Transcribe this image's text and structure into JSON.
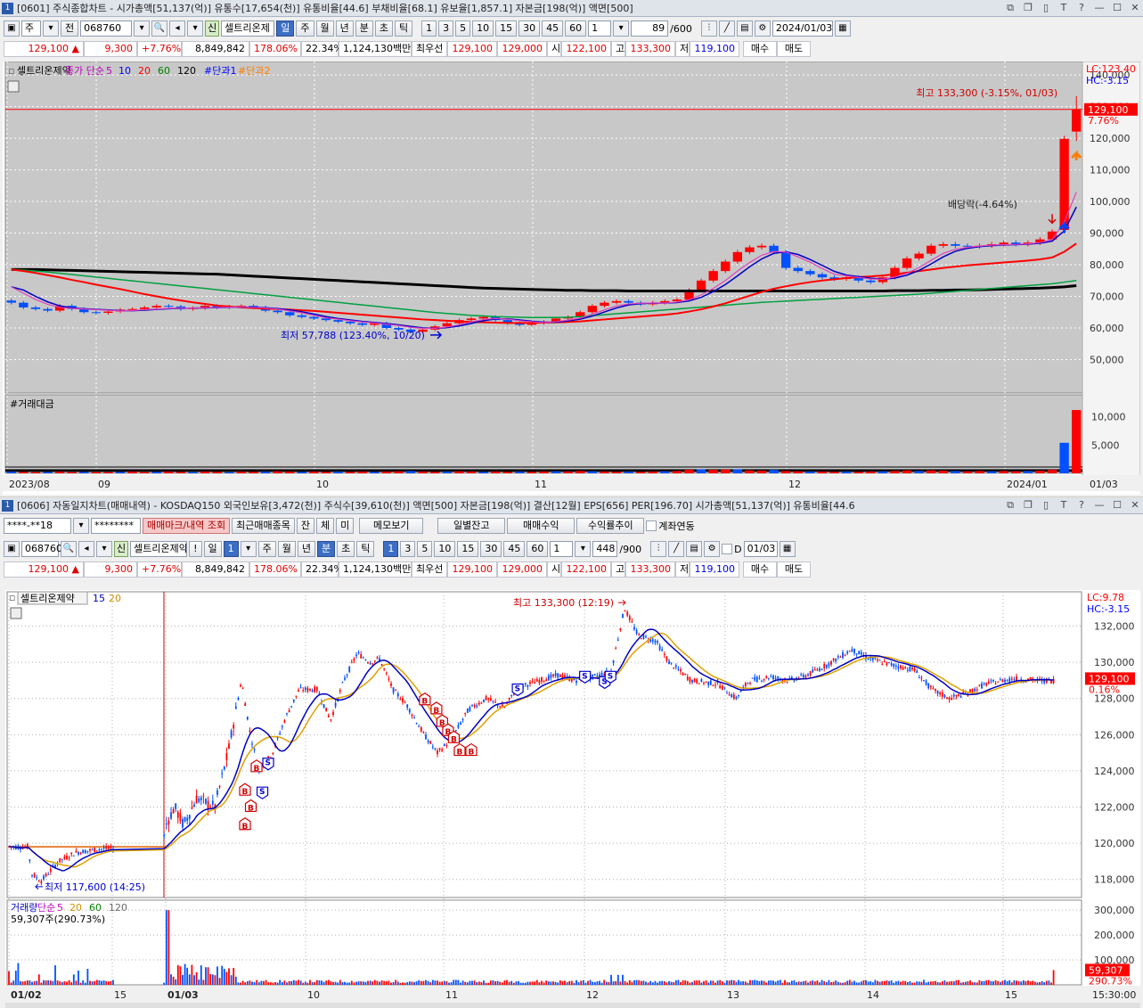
{
  "top": {
    "title_num": "1",
    "title": "[0601] 주식종합차트 - 시가총액[51,137(억)] 유통수[17,654(천)] 유통비율[44.6] 부채비율[68.1] 유보율[1,857.1] 자본금[198(억)] 액면[500]",
    "toolbar": {
      "type_sel": "주",
      "prev": "전",
      "code": "068760",
      "credit": "신",
      "name": "셀트리온제",
      "periods": [
        "일",
        "주",
        "월",
        "년",
        "분",
        "초",
        "틱"
      ],
      "active_period": "일",
      "nums": [
        "1",
        "3",
        "5",
        "10",
        "15",
        "30",
        "45",
        "60"
      ],
      "count_sel": "1",
      "count": "89",
      "count_max": "/600",
      "date": "2024/01/03"
    },
    "quote": {
      "price": "129,100",
      "change": "9,300",
      "rate": "+7.76%",
      "volume": "8,849,842",
      "vol_ratio": "178.06%",
      "turnover": "22.34%",
      "amount": "1,124,130백만",
      "best_label": "최우선",
      "ask": "129,100",
      "bid": "129,000",
      "open_label": "시",
      "open": "122,100",
      "high_label": "고",
      "high": "133,300",
      "low_label": "저",
      "low": "119,100",
      "buy": "매수",
      "sell": "매도"
    },
    "legend": {
      "name": "셀트리온제약",
      "ma_label": "종가 단순",
      "ma5": "5",
      "ma10": "10",
      "ma20": "20",
      "ma60": "60",
      "ma120": "120",
      "tr1": "#단과1",
      "tr2": "#단과2",
      "volume_title": "#거래대금"
    },
    "right_info": {
      "lc": "LC:123.40",
      "hc": "HC:-3.15"
    },
    "current": {
      "price": "129,100",
      "pct": "7.76%"
    },
    "annot_high": "최고 133,300 (-3.15%, 01/03)",
    "annot_low": "최저 57,788 (123.40%, 10/20)",
    "annot_div": "배당락(-4.64%)",
    "x_labels": [
      "2023/08",
      "09",
      "10",
      "11",
      "12",
      "2024/01"
    ],
    "x_right": "01/03",
    "chart_data": {
      "type": "candlestick",
      "y_ticks": [
        "140,000",
        "130,000",
        "120,000",
        "110,000",
        "100,000",
        "90,000",
        "80,000",
        "70,000",
        "60,000",
        "50,000"
      ],
      "ylim": [
        40000,
        142000
      ],
      "volume_ticks": [
        "10,000",
        "5,000"
      ],
      "closes": [
        68000,
        66500,
        66000,
        65500,
        67000,
        66000,
        65000,
        64800,
        65200,
        65800,
        66000,
        66500,
        67000,
        66800,
        66000,
        66300,
        67000,
        66500,
        66800,
        67000,
        66500,
        65500,
        65000,
        64000,
        63500,
        63000,
        62500,
        62000,
        61500,
        61000,
        61500,
        60000,
        59500,
        58800,
        59500,
        60500,
        61500,
        62500,
        63000,
        63500,
        62500,
        61500,
        61000,
        61500,
        62000,
        63000,
        63500,
        65000,
        67000,
        68000,
        68500,
        68000,
        67500,
        68000,
        68500,
        69000,
        72000,
        75000,
        78000,
        81000,
        84000,
        85500,
        86000,
        84000,
        79000,
        78000,
        77000,
        76000,
        75500,
        76000,
        75000,
        74500,
        76000,
        79000,
        82000,
        83500,
        86000,
        86500,
        86000,
        85800,
        86000,
        86500,
        87000,
        86500,
        87000,
        88000,
        90500,
        119800,
        129100
      ],
      "ma5": [
        73000,
        71000,
        69000,
        67500,
        66500,
        66200,
        66000,
        65800,
        65600,
        65400,
        65500,
        65800,
        66000,
        66200,
        66300,
        66300,
        66400,
        66500,
        66600,
        66600,
        66500,
        66300,
        66000,
        65400,
        64800,
        64000,
        63200,
        62800,
        62300,
        61900,
        61600,
        61200,
        60800,
        60200,
        59900,
        59900,
        60300,
        61000,
        61900,
        62700,
        63000,
        62800,
        62300,
        62000,
        61700,
        62000,
        62500,
        63100,
        64400,
        65700,
        67000,
        67600,
        67800,
        67900,
        67900,
        68200,
        68900,
        70500,
        72500,
        75000,
        78000,
        80700,
        83000,
        84200,
        84000,
        82500,
        80800,
        78800,
        77000,
        76500,
        76000,
        75500,
        75400,
        76100,
        77300,
        79100,
        81400,
        83600,
        84900,
        85500,
        85900,
        86200,
        86300,
        86400,
        86600,
        87000,
        87900,
        93500,
        103000
      ],
      "ma20": [
        78500,
        78000,
        77400,
        76700,
        76000,
        75200,
        74500,
        73700,
        73000,
        72300,
        71500,
        70700,
        70000,
        69300,
        68700,
        68100,
        67600,
        67100,
        66800,
        66500,
        66300,
        66100,
        66000,
        65800,
        65600,
        65400,
        65100,
        64800,
        64500,
        64200,
        63900,
        63600,
        63300,
        63000,
        62700,
        62500,
        62300,
        62100,
        61900,
        61800,
        61700,
        61600,
        61600,
        61600,
        61700,
        61800,
        61900,
        62100,
        62400,
        62700,
        63000,
        63300,
        63600,
        63900,
        64200,
        64600,
        65200,
        65900,
        66800,
        67800,
        69000,
        70200,
        71400,
        72400,
        73200,
        73900,
        74500,
        75000,
        75400,
        75800,
        76100,
        76300,
        76600,
        77000,
        77500,
        78000,
        78500,
        79000,
        79400,
        79800,
        80100,
        80400,
        80700,
        81000,
        81300,
        81700,
        82300,
        84100,
        86700
      ],
      "ma60": [
        78500,
        78300,
        78000,
        77700,
        77300,
        76900,
        76500,
        76100,
        75700,
        75300,
        74900,
        74500,
        74100,
        73700,
        73300,
        72900,
        72500,
        72100,
        71700,
        71300,
        70900,
        70500,
        70100,
        69700,
        69300,
        68900,
        68500,
        68100,
        67700,
        67300,
        66900,
        66500,
        66100,
        65700,
        65300,
        64900,
        64600,
        64300,
        64000,
        63800,
        63600,
        63500,
        63400,
        63300,
        63300,
        63300,
        63400,
        63600,
        63900,
        64200,
        64500,
        64800,
        65100,
        65400,
        65700,
        66000,
        66300,
        66600,
        66900,
        67200,
        67500,
        67800,
        68100,
        68300,
        68500,
        68700,
        68900,
        69100,
        69300,
        69500,
        69700,
        69900,
        70100,
        70300,
        70500,
        70700,
        71000,
        71300,
        71600,
        71900,
        72200,
        72500,
        72800,
        73100,
        73400,
        73700,
        74000,
        74500,
        75000
      ],
      "ma120": [
        78500,
        78500,
        78500,
        78400,
        78300,
        78200,
        78100,
        78000,
        77900,
        77800,
        77700,
        77600,
        77500,
        77400,
        77300,
        77200,
        77100,
        77000,
        76800,
        76600,
        76400,
        76200,
        76000,
        75800,
        75600,
        75400,
        75200,
        75000,
        74800,
        74600,
        74400,
        74200,
        74000,
        73800,
        73600,
        73400,
        73200,
        73000,
        72800,
        72600,
        72500,
        72400,
        72300,
        72200,
        72100,
        72000,
        71900,
        71900,
        71800,
        71800,
        71800,
        71700,
        71700,
        71700,
        71700,
        71700,
        71700,
        71700,
        71700,
        71700,
        71700,
        71700,
        71700,
        71700,
        71700,
        71700,
        71700,
        71700,
        71700,
        71700,
        71700,
        71700,
        71700,
        71800,
        71800,
        71800,
        71900,
        71900,
        72000,
        72000,
        72100,
        72200,
        72300,
        72400,
        72500,
        72600,
        72800,
        73000,
        73400
      ],
      "volume": [
        300,
        250,
        200,
        250,
        300,
        200,
        250,
        200,
        200,
        250,
        300,
        200,
        250,
        300,
        250,
        200,
        300,
        250,
        200,
        300,
        250,
        300,
        350,
        300,
        250,
        300,
        250,
        300,
        250,
        300,
        250,
        300,
        350,
        400,
        300,
        250,
        300,
        350,
        300,
        250,
        300,
        250,
        300,
        250,
        300,
        350,
        300,
        400,
        350,
        300,
        250,
        300,
        250,
        300,
        350,
        400,
        600,
        700,
        600,
        650,
        700,
        500,
        450,
        600,
        400,
        350,
        300,
        300,
        250,
        300,
        250,
        300,
        350,
        400,
        500,
        400,
        500,
        450,
        400,
        350,
        400,
        350,
        400,
        350,
        400,
        450,
        600,
        5400,
        11200
      ]
    }
  },
  "bottom": {
    "title_num": "1",
    "title": "[0606] 자동일지차트(매매내역) - KOSDAQ150 외국인보유[3,472(천)] 주식수[39,610(천)] 액면[500] 자본금[198(억)] 결산[12월] EPS[656] PER[196.70] 시가총액[51,137(억)] 유통비율[44.6",
    "account": "****-**18",
    "password": "********",
    "btns": [
      "매매마크/내역 조회",
      "최근매매종목",
      "잔",
      "체",
      "미",
      "메모보기",
      "일별잔고",
      "매매수익",
      "수익률추이"
    ],
    "account_link": "계좌연동",
    "toolbar": {
      "code": "068760",
      "credit": "신",
      "name": "셀트리온제약",
      "bang": "!",
      "period": "일",
      "period_num": "1",
      "periods": [
        "주",
        "월",
        "년",
        "분",
        "초",
        "틱"
      ],
      "active_period": "분",
      "nums": [
        "1",
        "3",
        "5",
        "10",
        "15",
        "30",
        "45",
        "60"
      ],
      "active_num": "1",
      "count_sel": "1",
      "count": "448",
      "count_max": "/900",
      "d_label": "D",
      "date": "01/03"
    },
    "quote": {
      "price": "129,100",
      "change": "9,300",
      "rate": "+7.76%",
      "volume": "8,849,842",
      "vol_ratio": "178.06%",
      "turnover": "22.34%",
      "amount": "1,124,130백만",
      "best_label": "최우선",
      "ask": "129,100",
      "bid": "129,000",
      "open_label": "시",
      "open": "122,100",
      "high_label": "고",
      "high": "133,300",
      "low_label": "저",
      "low": "119,100",
      "buy": "매수",
      "sell": "매도"
    },
    "legend": {
      "name": "셀트리온제약",
      "ma15": "15",
      "ma20": "20",
      "vol_label": "거래량",
      "vol_ma_label": "단순",
      "vma5": "5",
      "vma20": "20",
      "vma60": "60",
      "vma120": "120",
      "vol_value": "59,307주(290.73%)"
    },
    "right_info": {
      "lc": "LC:9.78",
      "hc": "HC:-3.15"
    },
    "current": {
      "price": "129,100",
      "pct": "0.16%"
    },
    "vol_current": {
      "value": "59,307",
      "pct": "290.73%"
    },
    "annot_high": "최고 133,300 (12:19)",
    "annot_low": "최저 117,600 (14:25)",
    "x_labels": [
      "01/02",
      "15",
      "01/03",
      "10",
      "11",
      "12",
      "13",
      "14",
      "15"
    ],
    "x_right": "15:30:00",
    "chart_data": {
      "type": "candlestick",
      "y_ticks": [
        "132,000",
        "130,000",
        "128,000",
        "126,000",
        "124,000",
        "122,000",
        "120,000",
        "118,000"
      ],
      "ylim": [
        117000,
        133900
      ],
      "volume_ticks": [
        "300,000",
        "200,000",
        "100,000"
      ],
      "trade_marks": [
        {
          "t": "B",
          "x": 0.215,
          "price": 124400
        },
        {
          "t": "S",
          "x": 0.22,
          "price": 123100
        },
        {
          "t": "B",
          "x": 0.205,
          "price": 123100
        },
        {
          "t": "B",
          "x": 0.21,
          "price": 122200
        },
        {
          "t": "B",
          "x": 0.205,
          "price": 121200
        },
        {
          "t": "S",
          "x": 0.225,
          "price": 124700
        },
        {
          "t": "B",
          "x": 0.36,
          "price": 128100
        },
        {
          "t": "B",
          "x": 0.37,
          "price": 127600
        },
        {
          "t": "B",
          "x": 0.375,
          "price": 126900
        },
        {
          "t": "B",
          "x": 0.38,
          "price": 126400
        },
        {
          "t": "B",
          "x": 0.385,
          "price": 126000
        },
        {
          "t": "B",
          "x": 0.39,
          "price": 125300
        },
        {
          "t": "B",
          "x": 0.4,
          "price": 125300
        },
        {
          "t": "S",
          "x": 0.44,
          "price": 128800
        },
        {
          "t": "S",
          "x": 0.498,
          "price": 129500
        },
        {
          "t": "S",
          "x": 0.515,
          "price": 129200
        },
        {
          "t": "S",
          "x": 0.52,
          "price": 129500
        }
      ]
    }
  }
}
